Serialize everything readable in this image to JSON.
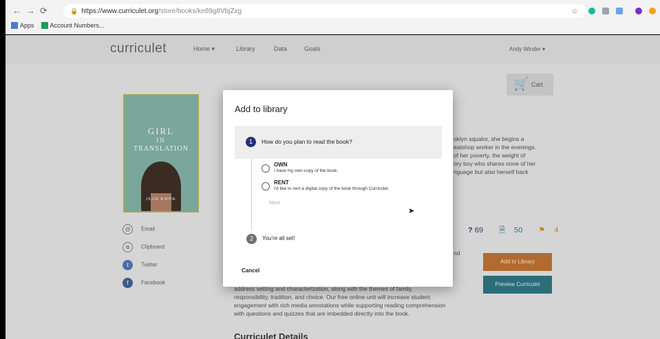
{
  "browser": {
    "back_icon": "arrow-left-icon",
    "url_host": "https://www.curriculet.org",
    "url_path": "/store/books/ke89g8VbjZxg",
    "bookmarks": [
      "Apps",
      "Account Numbers..."
    ]
  },
  "site": {
    "logo": "curriculet",
    "nav": [
      "Home ▾",
      "Library",
      "Data",
      "Goals"
    ],
    "user": "Andy Winder ▾",
    "cart_label": "Cart"
  },
  "book": {
    "cover_title_top": "GIRL",
    "cover_title_mid": "IN",
    "cover_title_bottom": "TRANSLATION",
    "cover_author": "JEAN KWOK"
  },
  "share": [
    "Email",
    "Clipboard",
    "Twitter",
    "Facebook"
  ],
  "description_snippets": [
    "oklyn squalor, she begins a",
    "eatshop worker in the evenings.",
    "of her poverty, the weight of",
    "ory boy who shares none of her",
    "nguage but also herself back"
  ],
  "nd_snippet": "nd",
  "stats": {
    "questions": "69",
    "quizzes": "50",
    "annotations": "4"
  },
  "buttons": {
    "add_to_library": "Add to Library",
    "preview": "Preview Curriculet"
  },
  "body_lines": [
    "address setting and characterization, along with the themes of family,",
    "responsibility, tradition, and choice. Our free online unit will increase student",
    "engagement with rich media annotations while supporting reading comprehension",
    "with questions and quizzes that are imbedded directly into the book."
  ],
  "details_heading": "Curriculet Details",
  "dialog": {
    "title": "Add to library",
    "step1_number": "1",
    "step1_label": "How do you plan to read the book?",
    "options": [
      {
        "title": "OWN",
        "desc": "I have my own copy of the book."
      },
      {
        "title": "RENT",
        "desc": "I'd like to rent a digital copy of the book through Curriculet."
      }
    ],
    "next_label": "Next",
    "step2_number": "2",
    "step2_label": "You're all set!",
    "cancel_label": "Cancel"
  }
}
